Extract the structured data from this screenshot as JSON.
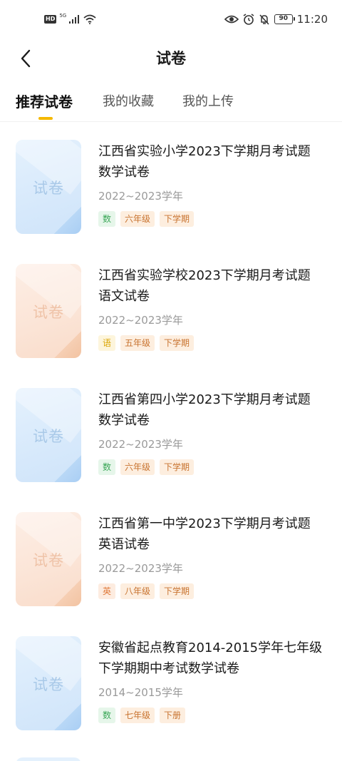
{
  "status_bar": {
    "left_badge": "HD",
    "signal_label": "5G",
    "battery": "90",
    "time": "11:20"
  },
  "header": {
    "title": "试卷"
  },
  "tabs": [
    {
      "label": "推荐试卷",
      "active": true
    },
    {
      "label": "我的收藏",
      "active": false
    },
    {
      "label": "我的上传",
      "active": false
    }
  ],
  "papers": [
    {
      "cover_label": "试卷",
      "cover_color": "blue",
      "title_line1": "江西省实验小学2023下学期月考试题",
      "title_line2": "数学试卷",
      "year": "2022~2023学年",
      "tags": {
        "subject": "数",
        "subject_style": "green",
        "grade": "六年级",
        "term": "下学期"
      }
    },
    {
      "cover_label": "试卷",
      "cover_color": "orange",
      "title_line1": "江西省实验学校2023下学期月考试题",
      "title_line2": "语文试卷",
      "year": "2022~2023学年",
      "tags": {
        "subject": "语",
        "subject_style": "yellow",
        "grade": "五年级",
        "term": "下学期"
      }
    },
    {
      "cover_label": "试卷",
      "cover_color": "blue",
      "title_line1": "江西省第四小学2023下学期月考试题",
      "title_line2": "数学试卷",
      "year": "2022~2023学年",
      "tags": {
        "subject": "数",
        "subject_style": "green",
        "grade": "六年级",
        "term": "下学期"
      }
    },
    {
      "cover_label": "试卷",
      "cover_color": "orange",
      "title_line1": "江西省第一中学2023下学期月考试题",
      "title_line2": "英语试卷",
      "year": "2022~2023学年",
      "tags": {
        "subject": "英",
        "subject_style": "orange",
        "grade": "八年级",
        "term": "下学期"
      }
    },
    {
      "cover_label": "试卷",
      "cover_color": "blue",
      "title_line1": "安徽省起点教育2014-2015学年七年级",
      "title_line2": "下学期期中考试数学试卷",
      "year": "2014~2015学年",
      "tags": {
        "subject": "数",
        "subject_style": "green",
        "grade": "七年级",
        "term": "下册"
      }
    }
  ],
  "colors": {
    "accent": "#f5b800",
    "tag_text": "#c8732f",
    "year_text": "#9a9a9a"
  }
}
